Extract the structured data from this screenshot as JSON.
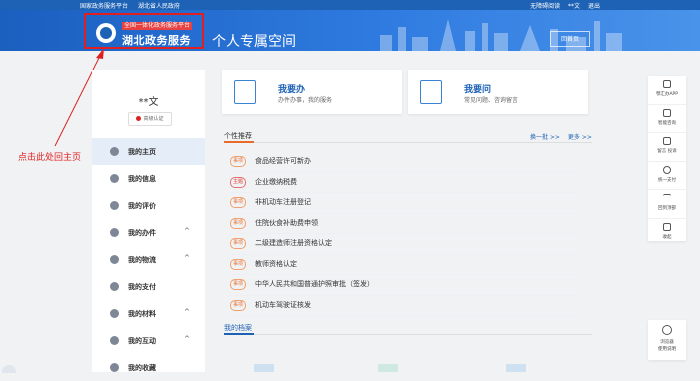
{
  "topbar": {
    "left_links": [
      "国家政务服务平台",
      "湖北省人民政府"
    ],
    "right_links": [
      "无障碍阅读",
      "**文",
      "退出"
    ]
  },
  "header": {
    "logo_small": "全国一体化政务服务平台",
    "logo_big": "湖北政务服务网",
    "space_title": "个人专属空间",
    "home_button": "回首页"
  },
  "annotation": {
    "text": "点击此处回主页",
    "color": "#e02020"
  },
  "user": {
    "name": "**文",
    "cert_badge": "高级认证"
  },
  "sidebar": {
    "items": [
      {
        "label": "我的主页",
        "icon": "home-icon",
        "active": true,
        "chevron": ""
      },
      {
        "label": "我的信息",
        "icon": "chat-icon",
        "active": false,
        "chevron": ""
      },
      {
        "label": "我的评价",
        "icon": "rating-icon",
        "active": false,
        "chevron": ""
      },
      {
        "label": "我的办件",
        "icon": "document-icon",
        "active": false,
        "chevron": "^"
      },
      {
        "label": "我的物流",
        "icon": "truck-icon",
        "active": false,
        "chevron": "^"
      },
      {
        "label": "我的支付",
        "icon": "payment-icon",
        "active": false,
        "chevron": ""
      },
      {
        "label": "我的材料",
        "icon": "folder-icon",
        "active": false,
        "chevron": "^"
      },
      {
        "label": "我的互动",
        "icon": "interaction-icon",
        "active": false,
        "chevron": "^"
      },
      {
        "label": "我的收藏",
        "icon": "star-icon",
        "active": false,
        "chevron": ""
      }
    ]
  },
  "cards": [
    {
      "title": "我要办",
      "subtitle": "办件办事，我的服务",
      "icon": "service-icon"
    },
    {
      "title": "我要问",
      "subtitle": "常见问题、咨询留言",
      "icon": "consult-icon"
    }
  ],
  "recommend": {
    "title": "个性推荐",
    "links": [
      "换一批 >>",
      "更多 >>"
    ],
    "items": [
      {
        "tag": "事项",
        "tag_color": "orange",
        "text": "食品经营许可新办"
      },
      {
        "tag": "主题",
        "tag_color": "red",
        "text": "企业缴纳税费"
      },
      {
        "tag": "事项",
        "tag_color": "orange",
        "text": "非机动车注册登记"
      },
      {
        "tag": "事项",
        "tag_color": "orange",
        "text": "住院伙食补助费申领"
      },
      {
        "tag": "事项",
        "tag_color": "orange",
        "text": "二级建造师注册资格认定"
      },
      {
        "tag": "事项",
        "tag_color": "orange",
        "text": "教师资格认定"
      },
      {
        "tag": "事项",
        "tag_color": "orange",
        "text": "中华人民共和国普通护照审批（签发）"
      },
      {
        "tag": "事项",
        "tag_color": "orange",
        "text": "机动车驾驶证核发"
      }
    ]
  },
  "archive": {
    "title": "我的档案"
  },
  "right_rail": {
    "items": [
      {
        "label": "鄂汇办APP",
        "icon": "phone-icon"
      },
      {
        "label": "智能咨询",
        "icon": "robot-icon"
      },
      {
        "label": "留言 投诉",
        "icon": "message-icon"
      },
      {
        "label": "统一支付",
        "icon": "yuan-icon"
      },
      {
        "label": "回到顶部",
        "icon": "top-icon"
      },
      {
        "label": "收起",
        "icon": "collapse-icon"
      }
    ],
    "browser": {
      "label_line1": "浏览器",
      "label_line2": "使用说明",
      "icon": "browser-icon"
    }
  },
  "colors": {
    "brand_blue": "#1e62b5",
    "accent_orange": "#e86b2a",
    "highlight_red": "#e02020"
  }
}
